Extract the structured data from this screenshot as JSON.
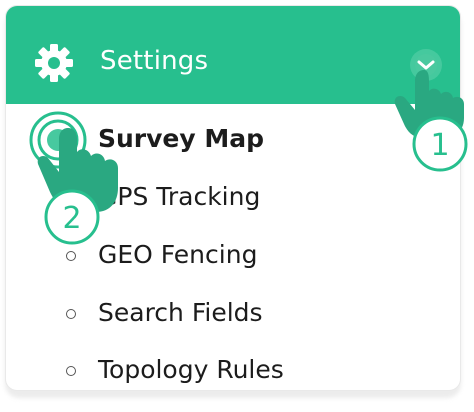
{
  "header": {
    "title": "Settings",
    "icon": "gear-icon",
    "toggle_icon": "chevron-down-icon"
  },
  "menu": {
    "items": [
      {
        "label": "Survey Map",
        "active": true
      },
      {
        "label": "GPS Tracking",
        "active": false
      },
      {
        "label": "GEO Fencing",
        "active": false
      },
      {
        "label": "Search Fields",
        "active": false
      },
      {
        "label": "Topology Rules",
        "active": false
      }
    ]
  },
  "steps": [
    {
      "number": "1",
      "target": "collapse toggle"
    },
    {
      "number": "2",
      "target": "Survey Map"
    }
  ],
  "colors": {
    "accent": "#27bf8e",
    "hand": "#2aa881"
  }
}
